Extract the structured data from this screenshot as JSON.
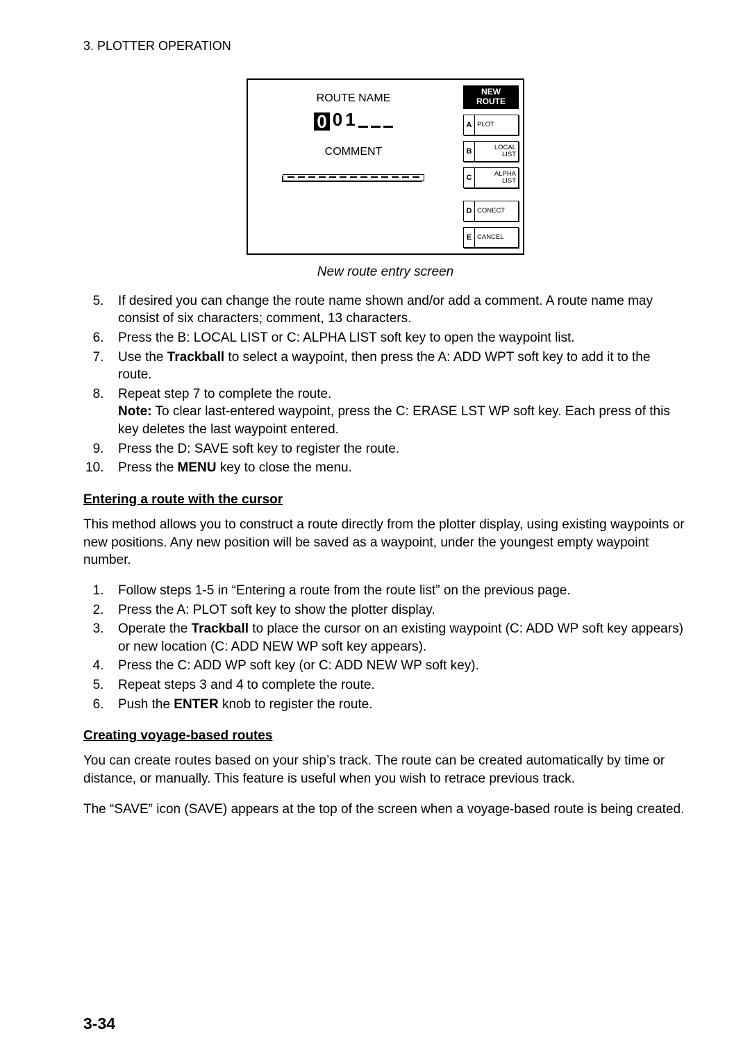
{
  "header": "3. PLOTTER OPERATION",
  "screen": {
    "route_name_label": "ROUTE NAME",
    "route_name_entered": [
      "0",
      "0",
      "1"
    ],
    "comment_label": "COMMENT",
    "title": "NEW\nROUTE",
    "keys": {
      "A": "PLOT",
      "B": "LOCAL\nLIST",
      "C": "ALPHA\nLIST",
      "D": "CONECT",
      "E": "CANCEL"
    }
  },
  "caption": "New route entry screen",
  "list1": {
    "i5": "If desired you can change the route name shown and/or add a comment. A route name may consist of six characters; comment, 13 characters.",
    "i6": "Press the B: LOCAL LIST or C: ALPHA LIST soft key to open the waypoint list.",
    "i7a": "Use the ",
    "i7b": "Trackball",
    "i7c": " to select a waypoint, then press the A: ADD WPT soft key to add it to the route.",
    "i8a": "Repeat step 7 to complete the route.",
    "i8note_label": "Note:",
    "i8note": " To clear last-entered waypoint, press the C: ERASE LST WP soft key. Each press of this key deletes the last waypoint entered.",
    "i9": "Press the D: SAVE soft key to register the route.",
    "i10a": "Press the ",
    "i10b": "MENU",
    "i10c": " key to close the menu."
  },
  "sub1": "Entering a route with the cursor",
  "para1": "This method allows you to construct a route directly from the plotter display, using existing waypoints or new positions. Any new position will be saved as a waypoint, under the youngest empty waypoint number.",
  "list2": {
    "i1": "Follow steps 1-5 in “Entering a route from the route list” on the previous page.",
    "i2": "Press the A: PLOT soft key to show the plotter display.",
    "i3a": "Operate the ",
    "i3b": "Trackball",
    "i3c": " to place the cursor on an existing waypoint (C: ADD WP soft key appears) or new location (C: ADD NEW WP soft key appears).",
    "i4": "Press the C: ADD WP soft key (or C: ADD NEW WP soft key).",
    "i5": "Repeat steps 3 and 4 to complete the route.",
    "i6a": "Push the ",
    "i6b": "ENTER",
    "i6c": " knob to register the route."
  },
  "sub2": "Creating voyage-based routes",
  "para2": "You can create routes based on your ship’s track. The route can be created automatically by time or distance, or manually. This feature is useful when you wish to retrace previous track.",
  "para3": "The “SAVE” icon (SAVE) appears at the top of the screen when a voyage-based route is being created.",
  "pagenum": "3-34"
}
